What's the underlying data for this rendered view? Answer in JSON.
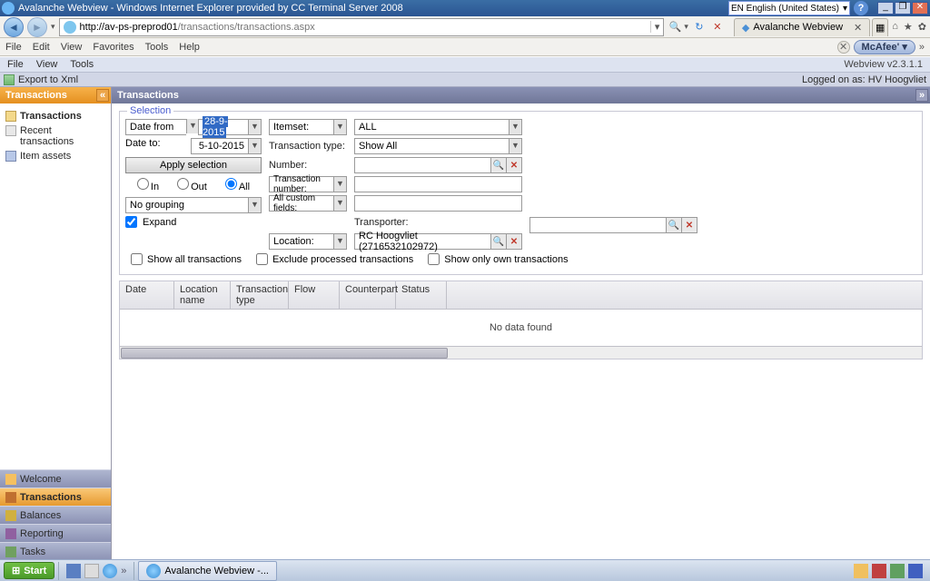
{
  "window": {
    "title": "Avalanche Webview - Windows Internet Explorer provided by CC Terminal Server 2008",
    "language": "EN English (United States)",
    "help": "?",
    "sys": {
      "min": "_",
      "max": "❐",
      "close": "✕"
    }
  },
  "ie": {
    "url_prefix": "http://av-ps-preprod01",
    "url_path": "/transactions/transactions.aspx",
    "search_icon": "🔍",
    "refresh_icon": "↻",
    "stop_icon": "✕",
    "tab_title": "Avalanche Webview",
    "tab_prefix_icon": "◆",
    "menubar": [
      "File",
      "Edit",
      "View",
      "Favorites",
      "Tools",
      "Help"
    ],
    "mcafee": "McAfee'",
    "chevron": "»",
    "right_icons": {
      "home": "⌂",
      "fav": "★",
      "gear": "✿"
    }
  },
  "app": {
    "menubar": [
      "File",
      "View",
      "Tools"
    ],
    "version": "Webview v2.3.1.1",
    "export": "Export to Xml",
    "logged_on": "Logged on as: HV Hoogvliet"
  },
  "sidebar": {
    "panel_title": "Transactions",
    "collapse": "«",
    "tree": [
      {
        "label": "Transactions",
        "icon": "folder",
        "bold": true
      },
      {
        "label": "Recent transactions",
        "icon": "doc",
        "bold": false
      },
      {
        "label": "Item assets",
        "icon": "cube",
        "bold": false
      }
    ],
    "nav": [
      {
        "label": "Welcome",
        "active": false
      },
      {
        "label": "Transactions",
        "active": true
      },
      {
        "label": "Balances",
        "active": false
      },
      {
        "label": "Reporting",
        "active": false
      },
      {
        "label": "Tasks",
        "active": false
      }
    ]
  },
  "content": {
    "title": "Transactions",
    "collapse": "»",
    "selection_legend": "Selection",
    "date_from_label": "Date from",
    "date_from_value": "28-9-2015",
    "date_to_label": "Date to:",
    "date_to_value": "5-10-2015",
    "apply": "Apply selection",
    "radio_in": "In",
    "radio_out": "Out",
    "radio_all": "All",
    "grouping": "No grouping",
    "expand": "Expand",
    "itemset_label": "Itemset:",
    "itemset_value": "ALL",
    "txtype_label": "Transaction type:",
    "txtype_value": "Show All",
    "number_label": "Number:",
    "txnum_label": "Transaction number:",
    "custom_label": "All custom fields:",
    "transporter_label": "Transporter:",
    "location_label": "Location:",
    "location_value": "RC Hoogvliet (2716532102972)",
    "search_icon": "🔍",
    "clear_icon": "✕",
    "showall": "Show all transactions",
    "exclude": "Exclude processed transactions",
    "own": "Show only own transactions",
    "grid_headers": [
      "Date",
      "Location name",
      "Transaction type",
      "Flow",
      "Counterpart",
      "Status"
    ],
    "nodata": "No data found"
  },
  "taskbar": {
    "start": "Start",
    "task": "Avalanche Webview -...",
    "chevron": "»"
  }
}
